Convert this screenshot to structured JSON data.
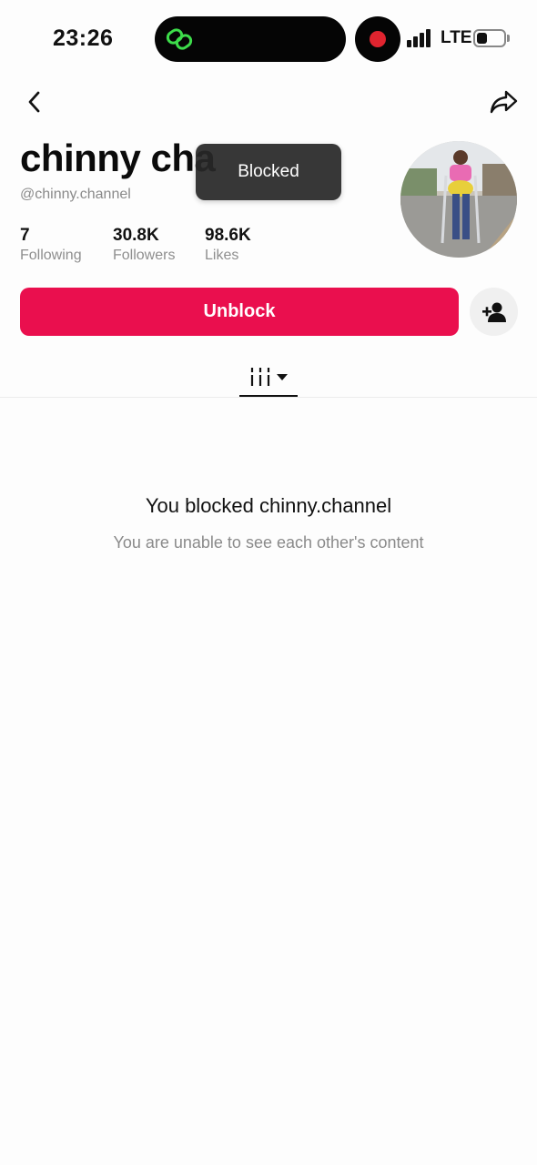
{
  "status_bar": {
    "time": "23:26",
    "network": "LTE",
    "icons": [
      "link-icon",
      "recording-dot-icon",
      "signal-icon",
      "battery-icon"
    ],
    "record_color": "#e0242f",
    "link_color": "#3ddc4a"
  },
  "header": {
    "back_icon": "chevron-left-icon",
    "share_icon": "share-arrow-icon"
  },
  "profile": {
    "name": "chinny cha",
    "handle": "@chinny.channel",
    "stats": [
      {
        "value": "7",
        "label": "Following"
      },
      {
        "value": "30.8K",
        "label": "Followers"
      },
      {
        "value": "98.6K",
        "label": "Likes"
      }
    ]
  },
  "toast": {
    "text": "Blocked"
  },
  "actions": {
    "unblock_label": "Unblock",
    "unblock_color": "#ea0f4e",
    "add_friend_icon": "person-add-icon"
  },
  "tabs": {
    "videos_icon": "videos-grid-icon",
    "dropdown_icon": "caret-down-icon"
  },
  "empty_state": {
    "title": "You blocked chinny.channel",
    "subtitle": "You are unable to see each other's content"
  }
}
